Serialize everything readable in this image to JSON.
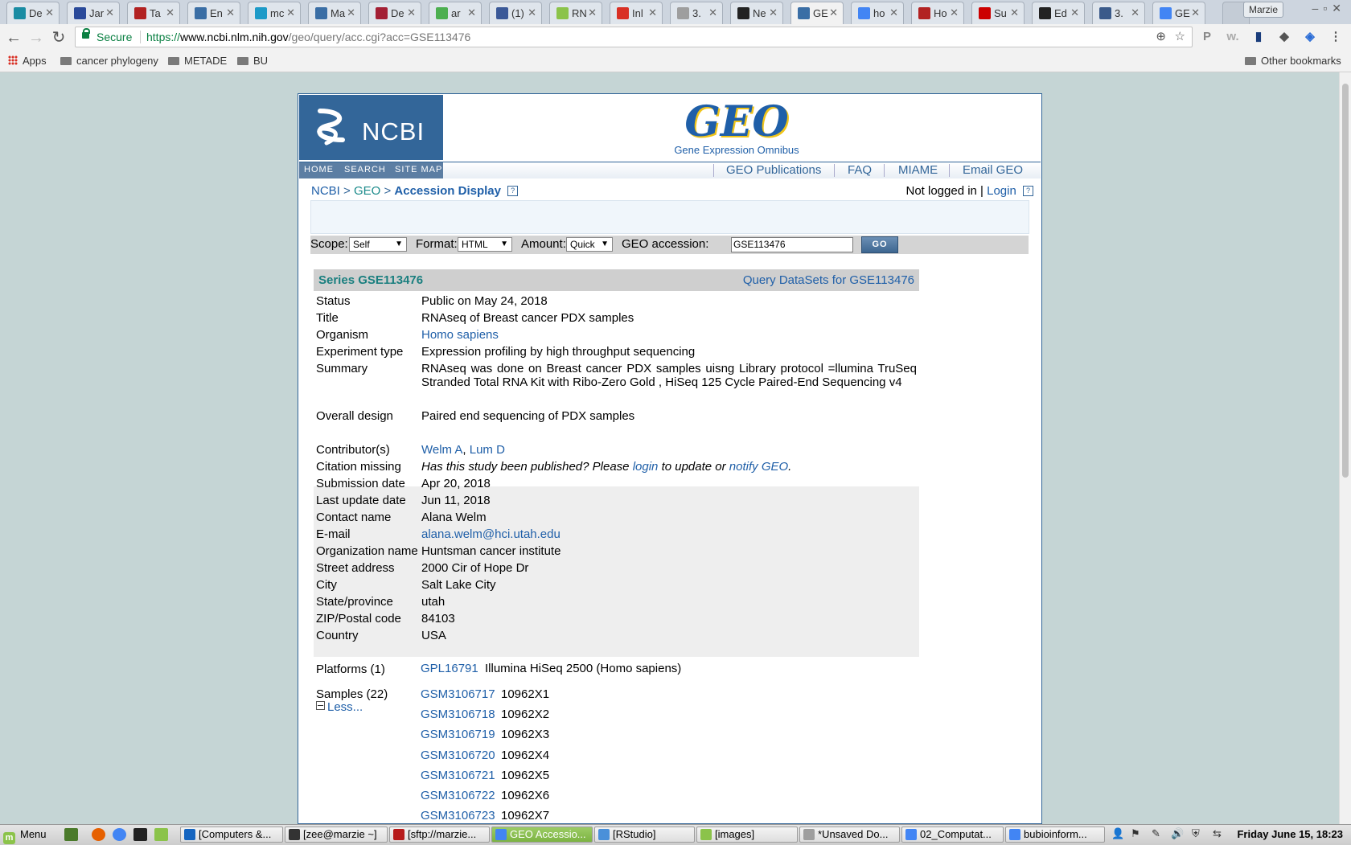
{
  "browser": {
    "tabs": [
      {
        "label": "De",
        "color": "#1a8ca3"
      },
      {
        "label": "Jar",
        "color": "#2a4a9a"
      },
      {
        "label": "Ta",
        "color": "#b22222"
      },
      {
        "label": "En",
        "color": "#3a6ea5"
      },
      {
        "label": "mc",
        "color": "#1c9ac8"
      },
      {
        "label": "Ma",
        "color": "#3a6ea5"
      },
      {
        "label": "De",
        "color": "#a31f34"
      },
      {
        "label": "ar",
        "color": "#4caf50"
      },
      {
        "label": "(1)",
        "color": "#3b5998"
      },
      {
        "label": "RN",
        "color": "#8bc34a"
      },
      {
        "label": "Inl",
        "color": "#d93025"
      },
      {
        "label": "3.",
        "color": "#9e9e9e"
      },
      {
        "label": "Ne",
        "color": "#222222"
      },
      {
        "label": "GE",
        "color": "#3a6ea5"
      },
      {
        "label": "ho",
        "color": "#4285f4"
      },
      {
        "label": "Ho",
        "color": "#b22222"
      },
      {
        "label": "Su",
        "color": "#cc0000"
      },
      {
        "label": "Ed",
        "color": "#222222"
      },
      {
        "label": "3.",
        "color": "#3a5a8a"
      },
      {
        "label": "GE",
        "color": "#4285f4"
      }
    ],
    "active_tab_index": 13,
    "profile_name": "Marzie",
    "secure_label": "Secure",
    "url_scheme": "https://",
    "url_domain": "www.ncbi.nlm.nih.gov",
    "url_path": "/geo/query/acc.cgi?acc=GSE113476",
    "bookmarks": {
      "apps": "Apps",
      "items": [
        "cancer phylogeny",
        "METADE",
        "BU"
      ],
      "other": "Other bookmarks"
    }
  },
  "header": {
    "ncbi_logo": "NCBI",
    "geo_logo": "GEO",
    "geo_subtitle": "Gene Expression Omnibus",
    "left_nav": [
      "HOME",
      "SEARCH",
      "SITE MAP"
    ],
    "right_nav": [
      "GEO Publications",
      "FAQ",
      "MIAME",
      "Email GEO"
    ]
  },
  "breadcrumb": {
    "ncbi": "NCBI",
    "sep1": ">",
    "geo": "GEO",
    "sep2": ">",
    "current": "Accession Display",
    "help": "?"
  },
  "login": {
    "status": "Not logged in |",
    "link": "Login",
    "help": "?"
  },
  "query_bar": {
    "scope_label": "Scope:",
    "scope_value": "Self",
    "format_label": "Format:",
    "format_value": "HTML",
    "amount_label": "Amount:",
    "amount_value": "Quick",
    "accession_label": "GEO accession:",
    "accession_value": "GSE113476",
    "go_label": "GO"
  },
  "series": {
    "title": "Series GSE113476",
    "query_link": "Query DataSets for GSE113476",
    "fields": {
      "status": {
        "label": "Status",
        "value": "Public on May 24, 2018"
      },
      "title": {
        "label": "Title",
        "value": "RNAseq of Breast cancer PDX samples"
      },
      "organism": {
        "label": "Organism",
        "value": "Homo sapiens"
      },
      "experiment_type": {
        "label": "Experiment type",
        "value": "Expression profiling by high throughput sequencing"
      },
      "summary": {
        "label": "Summary",
        "value": "RNAseq was done on Breast cancer PDX samples uisng Library protocol =llumina TruSeq Stranded Total RNA Kit with Ribo-Zero Gold , HiSeq 125 Cycle Paired-End Sequencing v4"
      },
      "overall_design": {
        "label": "Overall design",
        "value": "Paired end sequencing of PDX samples"
      },
      "contributors": {
        "label": "Contributor(s)",
        "names": [
          "Welm A",
          "Lum D"
        ],
        "sep": ","
      },
      "citation": {
        "label": "Citation missing",
        "text1": "Has this study been published? Please",
        "login_link": "login",
        "text2": "to update or",
        "notify_link": "notify GEO",
        "text3": "."
      },
      "submission_date": {
        "label": "Submission date",
        "value": "Apr 20, 2018"
      },
      "last_update": {
        "label": "Last update date",
        "value": "Jun 11, 2018"
      },
      "contact": {
        "label": "Contact name",
        "value": "Alana Welm"
      },
      "email": {
        "label": "E-mail",
        "value": "alana.welm@hci.utah.edu"
      },
      "organization": {
        "label": "Organization name",
        "value": "Huntsman cancer institute"
      },
      "street": {
        "label": "Street address",
        "value": "2000 Cir of Hope Dr"
      },
      "city": {
        "label": "City",
        "value": "Salt Lake City"
      },
      "state": {
        "label": "State/province",
        "value": "utah"
      },
      "zip": {
        "label": "ZIP/Postal code",
        "value": "84103"
      },
      "country": {
        "label": "Country",
        "value": "USA"
      }
    },
    "platforms": {
      "label": "Platforms (1)",
      "id": "GPL16791",
      "name": "Illumina HiSeq 2500 (Homo sapiens)"
    },
    "samples": {
      "label": "Samples (22)",
      "less": "Less...",
      "items": [
        {
          "id": "GSM3106717",
          "name": "10962X1"
        },
        {
          "id": "GSM3106718",
          "name": "10962X2"
        },
        {
          "id": "GSM3106719",
          "name": "10962X3"
        },
        {
          "id": "GSM3106720",
          "name": "10962X4"
        },
        {
          "id": "GSM3106721",
          "name": "10962X5"
        },
        {
          "id": "GSM3106722",
          "name": "10962X6"
        },
        {
          "id": "GSM3106723",
          "name": "10962X7"
        }
      ]
    }
  },
  "taskbar": {
    "menu_label": "Menu",
    "windows": [
      {
        "label": "[Computers &...",
        "color": "#1565c0"
      },
      {
        "label": "[zee@marzie ~]",
        "color": "#333333"
      },
      {
        "label": "[sftp://marzie...",
        "color": "#b71c1c"
      },
      {
        "label": "GEO Accessio...",
        "color": "#4285f4"
      },
      {
        "label": "[RStudio]",
        "color": "#4a90d9"
      },
      {
        "label": "[images]",
        "color": "#8bc34a"
      },
      {
        "label": "*Unsaved Do...",
        "color": "#9e9e9e"
      },
      {
        "label": "02_Computat...",
        "color": "#4285f4"
      },
      {
        "label": "bubioinform...",
        "color": "#4285f4"
      }
    ],
    "active_window_index": 3,
    "clock": "Friday June 15, 18:23"
  }
}
